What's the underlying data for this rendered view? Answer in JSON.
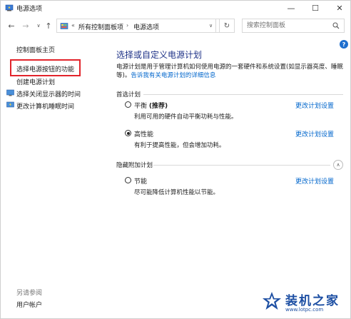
{
  "window": {
    "title": "电源选项",
    "controls": {
      "minimize": "—",
      "maximize": "☐",
      "close": "✕"
    }
  },
  "nav": {
    "back": "←",
    "forward": "→",
    "recent": "∨",
    "up": "↑",
    "breadcrumb_prefix": "«",
    "breadcrumbs": [
      "所有控制面板项",
      "电源选项"
    ],
    "breadcrumb_sep": "›",
    "dropdown": "∨",
    "refresh": "↻",
    "search_placeholder": "搜索控制面板"
  },
  "sidebar": {
    "items": [
      {
        "label": "控制面板主页"
      },
      {
        "label": "选择电源按钮的功能"
      },
      {
        "label": "创建电源计划"
      },
      {
        "label": "选择关闭显示器的时间"
      },
      {
        "label": "更改计算机睡眠时间"
      }
    ],
    "see_also": "另请参阅",
    "user_accounts": "用户帐户"
  },
  "main": {
    "heading": "选择或自定义电源计划",
    "description": "电源计划是用于管理计算机如何使用电源的一套硬件和系统设置(如显示器亮度、睡眠等)。",
    "description_link": "告诉我有关电源计划的详细信息",
    "preferred_group": "首选计划",
    "hidden_group": "隐藏附加计划",
    "collapse": "∧",
    "plans": [
      {
        "name": "平衡",
        "tag": "(推荐)",
        "desc": "利用可用的硬件自动平衡功耗与性能。",
        "change": "更改计划设置",
        "selected": false
      },
      {
        "name": "高性能",
        "tag": "",
        "desc": "有利于提高性能，但会增加功耗。",
        "change": "更改计划设置",
        "selected": true
      },
      {
        "name": "节能",
        "tag": "",
        "desc": "尽可能降低计算机性能以节能。",
        "change": "更改计划设置",
        "selected": false
      }
    ],
    "help": "?"
  },
  "watermark": {
    "text": "装机之家",
    "url": "www.lotpc.com"
  },
  "colors": {
    "heading": "#1e3287",
    "link": "#0066cc",
    "highlight": "#e2242b"
  }
}
